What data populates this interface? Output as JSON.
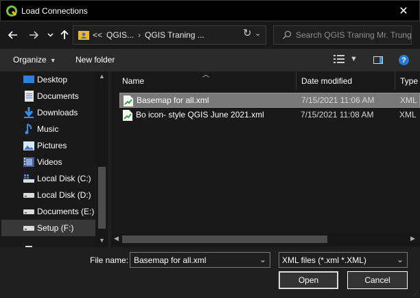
{
  "window": {
    "title": "Load Connections",
    "close_glyph": "✕"
  },
  "address": {
    "overflow": "<<",
    "crumbs": [
      "QGIS...",
      "QGIS Traning ..."
    ],
    "separator": "›",
    "search_placeholder": "Search QGIS Traning Mr. Trung"
  },
  "toolbar": {
    "organize": "Organize",
    "new_folder": "New folder"
  },
  "nav": {
    "items": [
      {
        "label": "Desktop",
        "icon": "desktop-icon"
      },
      {
        "label": "Documents",
        "icon": "documents-icon"
      },
      {
        "label": "Downloads",
        "icon": "downloads-icon"
      },
      {
        "label": "Music",
        "icon": "music-icon"
      },
      {
        "label": "Pictures",
        "icon": "pictures-icon"
      },
      {
        "label": "Videos",
        "icon": "videos-icon"
      },
      {
        "label": "Local Disk (C:)",
        "icon": "drive-icon"
      },
      {
        "label": "Local Disk (D:)",
        "icon": "drive-icon"
      },
      {
        "label": "Documents (E:)",
        "icon": "drive-icon"
      },
      {
        "label": "Setup (F:)",
        "icon": "drive-icon",
        "selected": true
      }
    ]
  },
  "files": {
    "columns": {
      "name": "Name",
      "date": "Date modified",
      "type": "Type"
    },
    "rows": [
      {
        "name": "Basemap for all.xml",
        "date": "7/15/2021 11:06 AM",
        "type": "XML",
        "selected": true
      },
      {
        "name": "Bo icon- style QGIS June 2021.xml",
        "date": "7/15/2021 11:08 AM",
        "type": "XML",
        "selected": false
      }
    ]
  },
  "bottom": {
    "file_name_label": "File name:",
    "file_name_value": "Basemap for all.xml",
    "filter_value": "XML files (*.xml *.XML)",
    "open_label": "Open",
    "cancel_label": "Cancel"
  },
  "colors": {
    "accent": "#2a79d8",
    "selection": "#787878"
  }
}
